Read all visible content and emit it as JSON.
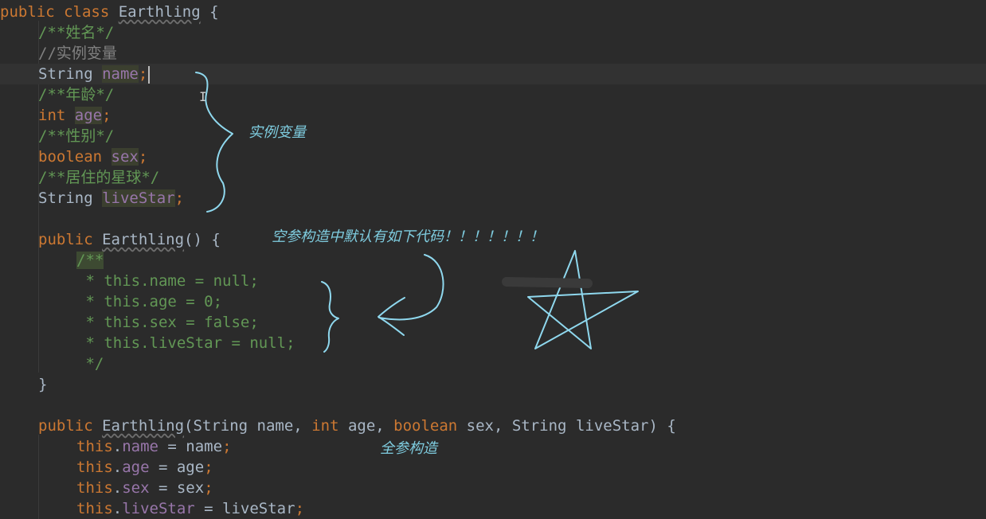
{
  "editor": {
    "lines": [
      [
        {
          "t": "public class ",
          "c": "kw"
        },
        {
          "t": "Earthling",
          "c": "plain wavy"
        },
        {
          "t": " {",
          "c": "plain"
        }
      ],
      [
        {
          "t": "/**姓名*/",
          "c": "doc"
        }
      ],
      [
        {
          "t": "//实例变量",
          "c": "cmt"
        }
      ],
      [
        {
          "t": "String ",
          "c": "plain"
        },
        {
          "t": "name",
          "c": "fld hl"
        },
        {
          "t": ";",
          "c": "kw"
        }
      ],
      [
        {
          "t": "/**年龄*/",
          "c": "doc"
        }
      ],
      [
        {
          "t": "int ",
          "c": "kw"
        },
        {
          "t": "age",
          "c": "fld hl"
        },
        {
          "t": ";",
          "c": "kw"
        }
      ],
      [
        {
          "t": "/**性别*/",
          "c": "doc"
        }
      ],
      [
        {
          "t": "boolean ",
          "c": "kw"
        },
        {
          "t": "sex",
          "c": "fld hl"
        },
        {
          "t": ";",
          "c": "kw"
        }
      ],
      [
        {
          "t": "/**居住的星球*/",
          "c": "doc"
        }
      ],
      [
        {
          "t": "String ",
          "c": "plain"
        },
        {
          "t": "liveStar",
          "c": "fld hl"
        },
        {
          "t": ";",
          "c": "kw"
        }
      ],
      [],
      [
        {
          "t": "public ",
          "c": "kw"
        },
        {
          "t": "Earthling",
          "c": "plain wavy"
        },
        {
          "t": "() {",
          "c": "plain"
        }
      ],
      [
        {
          "t": "/**",
          "c": "doc hl2"
        }
      ],
      [
        {
          "t": " * this.name = null;",
          "c": "doc"
        }
      ],
      [
        {
          "t": " * this.age = 0;",
          "c": "doc"
        }
      ],
      [
        {
          "t": " * this.sex = false;",
          "c": "doc"
        }
      ],
      [
        {
          "t": " * this.liveStar = null;",
          "c": "doc"
        }
      ],
      [
        {
          "t": " */",
          "c": "doc"
        }
      ],
      [
        {
          "t": "}",
          "c": "plain"
        }
      ],
      [],
      [
        {
          "t": "public ",
          "c": "kw"
        },
        {
          "t": "Earthling",
          "c": "plain wavy"
        },
        {
          "t": "(String name, ",
          "c": "plain"
        },
        {
          "t": "int ",
          "c": "kw"
        },
        {
          "t": "age, ",
          "c": "plain"
        },
        {
          "t": "boolean ",
          "c": "kw"
        },
        {
          "t": "sex, String liveStar) {",
          "c": "plain"
        }
      ],
      [
        {
          "t": "this",
          "c": "kw"
        },
        {
          "t": ".",
          "c": "plain"
        },
        {
          "t": "name",
          "c": "fld"
        },
        {
          "t": " = name",
          "c": "plain"
        },
        {
          "t": ";",
          "c": "kw"
        }
      ],
      [
        {
          "t": "this",
          "c": "kw"
        },
        {
          "t": ".",
          "c": "plain"
        },
        {
          "t": "age",
          "c": "fld"
        },
        {
          "t": " = age",
          "c": "plain"
        },
        {
          "t": ";",
          "c": "kw"
        }
      ],
      [
        {
          "t": "this",
          "c": "kw"
        },
        {
          "t": ".",
          "c": "plain"
        },
        {
          "t": "sex",
          "c": "fld"
        },
        {
          "t": " = sex",
          "c": "plain"
        },
        {
          "t": ";",
          "c": "kw"
        }
      ],
      [
        {
          "t": "this",
          "c": "kw"
        },
        {
          "t": ".",
          "c": "plain"
        },
        {
          "t": "liveStar",
          "c": "fld"
        },
        {
          "t": " = liveStar",
          "c": "plain"
        },
        {
          "t": ";",
          "c": "kw"
        }
      ]
    ]
  },
  "annotations": {
    "instance_vars": "实例变量",
    "default_ctor": "空参构造中默认有如下代码！！！！！！！",
    "full_ctor": "全参构造"
  },
  "colors": {
    "background": "#2b2b2b",
    "keyword": "#cc7832",
    "text": "#a9b7c6",
    "line_comment": "#808080",
    "doc_comment": "#629755",
    "field": "#9876aa",
    "ink": "#8fd8ee"
  }
}
